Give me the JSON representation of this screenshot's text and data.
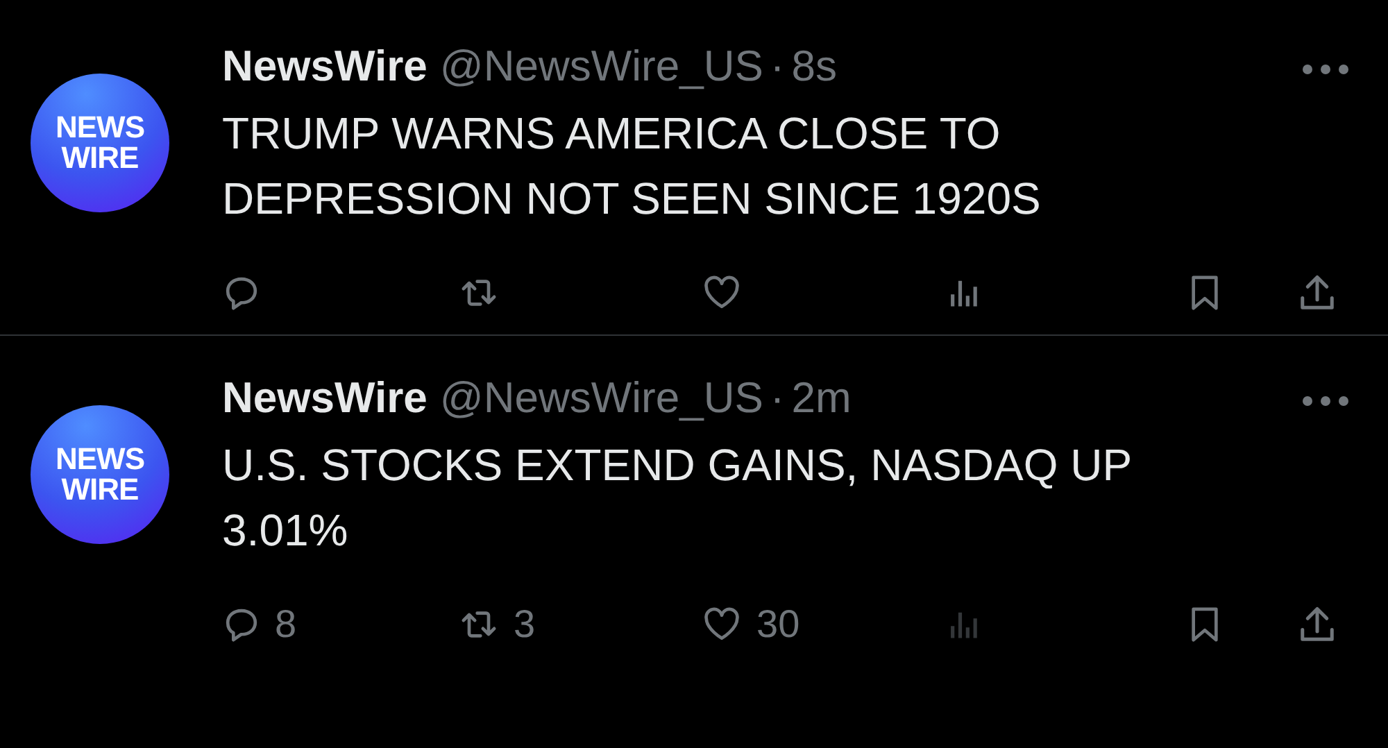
{
  "tweets": [
    {
      "avatar_text": [
        "NEWS",
        "WIRE"
      ],
      "name": "NewsWire",
      "handle": "@NewsWire_US",
      "separator": "·",
      "time": "8s",
      "text": "TRUMP WARNS AMERICA CLOSE TO DEPRESSION NOT SEEN SINCE 1920S",
      "views_disabled": false
    },
    {
      "avatar_text": [
        "NEWS",
        "WIRE"
      ],
      "name": "NewsWire",
      "handle": "@NewsWire_US",
      "separator": "·",
      "time": "2m",
      "text": "U.S. STOCKS EXTEND GAINS, NASDAQ UP 3.01%",
      "replies": "8",
      "retweets": "3",
      "likes": "30",
      "views_disabled": true
    }
  ]
}
